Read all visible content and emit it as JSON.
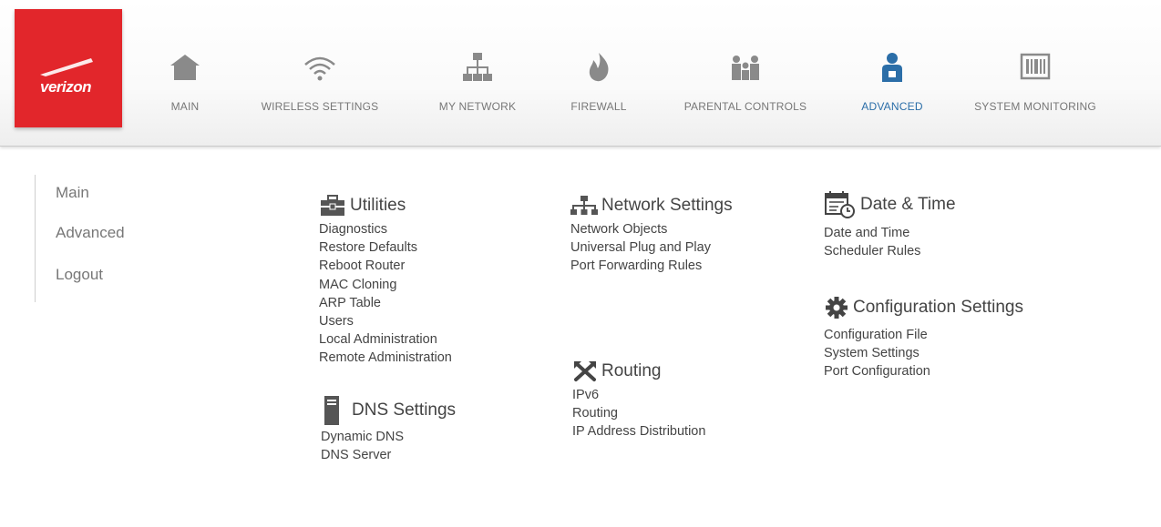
{
  "brand": {
    "logo_text": "verizon"
  },
  "nav": [
    {
      "label": "MAIN",
      "icon": "house-icon"
    },
    {
      "label": "WIRELESS SETTINGS",
      "icon": "wifi-icon"
    },
    {
      "label": "MY NETWORK",
      "icon": "network-icon"
    },
    {
      "label": "FIREWALL",
      "icon": "flame-icon"
    },
    {
      "label": "PARENTAL CONTROLS",
      "icon": "family-icon"
    },
    {
      "label": "ADVANCED",
      "icon": "person-badge-icon",
      "active": true
    },
    {
      "label": "SYSTEM MONITORING",
      "icon": "monitor-icon"
    }
  ],
  "colors": {
    "brand_red": "#e2262b",
    "active_blue": "#2b6ea8",
    "icon_gray": "#8a8a8a"
  },
  "sidebar": [
    {
      "label": "Main"
    },
    {
      "label": "Advanced"
    },
    {
      "label": "Logout"
    }
  ],
  "sections": {
    "utilities": {
      "title": "Utilities",
      "links": [
        "Diagnostics",
        "Restore Defaults",
        "Reboot Router",
        "MAC Cloning",
        "ARP Table",
        "Users",
        "Local Administration",
        "Remote Administration"
      ]
    },
    "dns": {
      "title": "DNS Settings",
      "links": [
        "Dynamic DNS",
        "DNS Server"
      ]
    },
    "network": {
      "title": "Network Settings",
      "links": [
        "Network Objects",
        "Universal Plug and Play",
        "Port Forwarding Rules"
      ]
    },
    "routing": {
      "title": "Routing",
      "links": [
        "IPv6",
        "Routing",
        "IP Address Distribution"
      ]
    },
    "datetime": {
      "title": "Date & Time",
      "links": [
        "Date and Time",
        "Scheduler Rules"
      ]
    },
    "config": {
      "title": "Configuration Settings",
      "links": [
        "Configuration File",
        "System Settings",
        "Port Configuration"
      ]
    }
  }
}
